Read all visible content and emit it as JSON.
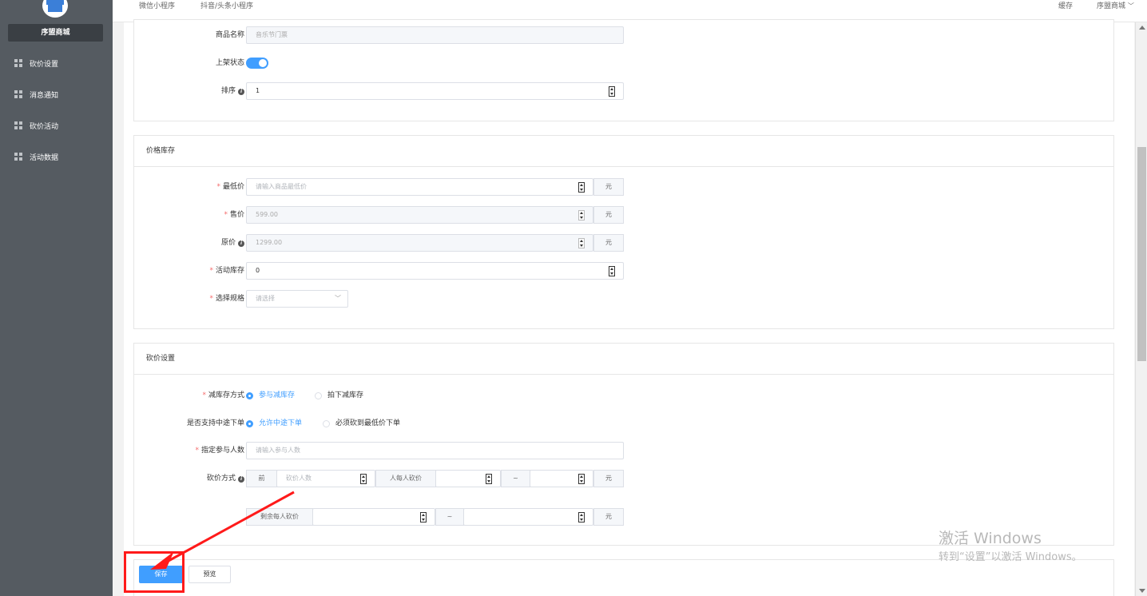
{
  "sidebar": {
    "brand": "序盟商城",
    "items": [
      {
        "label": "砍价设置",
        "icon": "grid-icon"
      },
      {
        "label": "消息通知",
        "icon": "grid-icon"
      },
      {
        "label": "砍价活动",
        "icon": "grid-icon"
      },
      {
        "label": "活动数据",
        "icon": "grid-icon"
      }
    ]
  },
  "topbar": {
    "tabs": [
      "微信小程序",
      "抖音/头条小程序"
    ],
    "cache": "缓存",
    "account": "序盟商城",
    "account_caret": "﹀"
  },
  "basic": {
    "name_label": "商品名称",
    "name_value": "音乐节门票",
    "status_label": "上架状态",
    "status_on": true,
    "sort_label": "排序",
    "sort_value": "1"
  },
  "price_stock": {
    "title": "价格库存",
    "min_price_label": "最低价",
    "min_price_placeholder": "请输入商品最低价",
    "sale_price_label": "售价",
    "sale_price_value": "599.00",
    "orig_price_label": "原价",
    "orig_price_value": "1299.00",
    "stock_label": "活动库存",
    "stock_value": "0",
    "spec_label": "选择规格",
    "spec_placeholder": "请选择",
    "unit": "元"
  },
  "bargain": {
    "title": "砍价设置",
    "reduce_label": "减库存方式",
    "reduce_options": [
      "参与减库存",
      "拍下减库存"
    ],
    "midway_label": "是否支持中途下单",
    "midway_options": [
      "允许中途下单",
      "必须砍到最低价下单"
    ],
    "participants_label": "指定参与人数",
    "participants_placeholder": "请输入参与人数",
    "method_label": "砍价方式",
    "front": "前",
    "front_placeholder": "砍价人数",
    "per_person": "人每人砍价",
    "tilde": "~",
    "remaining": "剩余每人砍价",
    "unit": "元"
  },
  "actions": {
    "save": "保存",
    "preview": "预览"
  },
  "watermark": {
    "line1": "激活 Windows",
    "line2": "转到“设置”以激活 Windows。"
  },
  "colors": {
    "primary": "#409eff",
    "sidebar": "#555b61",
    "required": "#f56c6c",
    "annotation": "#ff1a1a"
  }
}
